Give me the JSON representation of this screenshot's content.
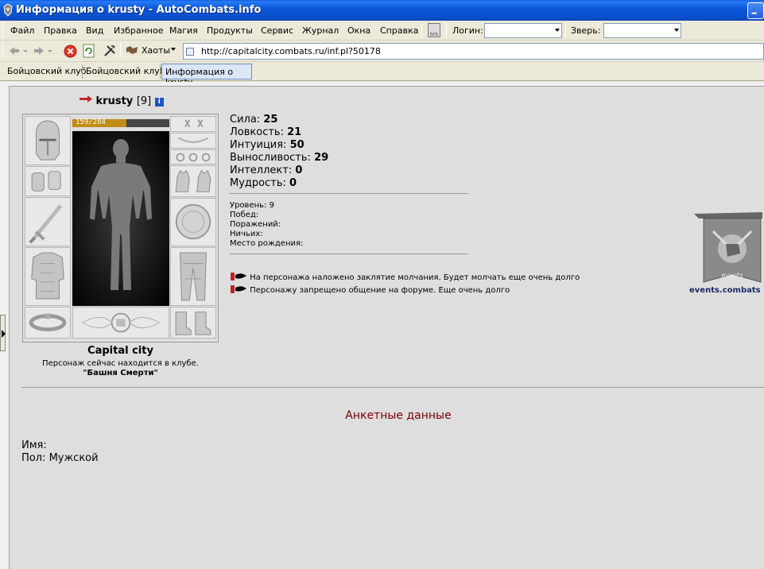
{
  "window": {
    "title": "Информация о krusty - AutoCombats.info"
  },
  "menu": {
    "items": [
      "Файл",
      "Правка",
      "Вид",
      "Избранное",
      "Магия",
      "Продукты",
      "Сервис",
      "Журнал",
      "Окна",
      "Справка"
    ],
    "login_label": "Логин:",
    "login_value": "",
    "pet_label": "Зверь:",
    "pet_value": ""
  },
  "toolbar": {
    "chaos_label": "Хаоты",
    "address": "http://capitalcity.combats.ru/inf.pl?50178"
  },
  "tabs": [
    {
      "label": "Бойцовский клуб",
      "active": false
    },
    {
      "label": "Бойцовский клуб",
      "active": false
    },
    {
      "label": "Информация о krusty",
      "active": true
    }
  ],
  "character": {
    "name": "krusty",
    "level_badge": "[9]",
    "hp_text": "159/284",
    "hp_fraction": 0.56,
    "city": "Capital city",
    "location_text": "Персонаж сейчас находится в клубе.",
    "location_place": "\"Башня Смерти\""
  },
  "stats": [
    {
      "label": "Сила:",
      "value": "25"
    },
    {
      "label": "Ловкость:",
      "value": "21"
    },
    {
      "label": "Интуиция:",
      "value": "50"
    },
    {
      "label": "Выносливость:",
      "value": "29"
    },
    {
      "label": "Интеллект:",
      "value": "0"
    },
    {
      "label": "Мудрость:",
      "value": "0"
    }
  ],
  "info": {
    "level": "Уровень: 9",
    "wins": "Побед:",
    "losses": "Поражений:",
    "draws": "Ничьих:",
    "birthplace": "Место рождения:"
  },
  "notices": [
    "На персонажа наложено заклятие молчания. Будет молчать еще очень долго",
    "Персонажу запрещено общение на форуме. Еще очень долго"
  ],
  "events": {
    "banner_text": "events",
    "label": "events.combats"
  },
  "anketa": {
    "title": "Анкетные данные",
    "name_label": "Имя:",
    "gender_label": "Пол:",
    "gender_value": "Мужской"
  },
  "colors": {
    "titlebar": "#0a57d8",
    "anketa_title": "#7a0000",
    "hp_fill": "#c08c14",
    "events_label": "#1a2a6a"
  }
}
